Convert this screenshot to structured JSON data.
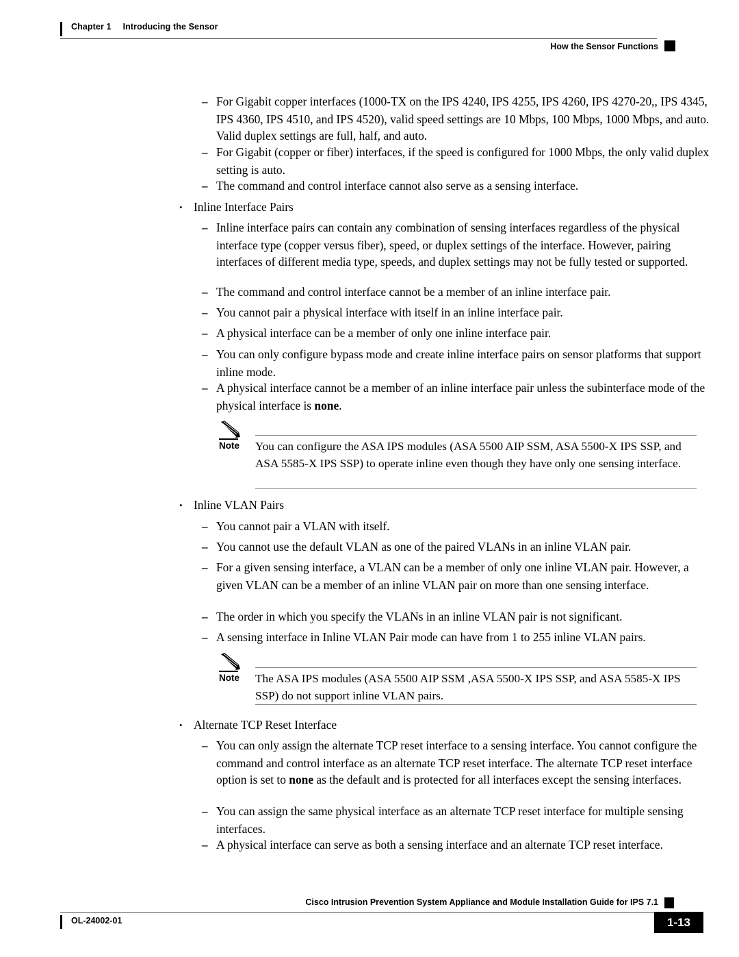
{
  "header": {
    "chapter_number": "Chapter 1",
    "chapter_title": "Introducing the Sensor",
    "section_title": "How the Sensor Functions"
  },
  "footer": {
    "guide_title": "Cisco Intrusion Prevention System Appliance and Module Installation Guide for IPS 7.1",
    "document_id": "OL-24002-01",
    "page_number": "1-13"
  },
  "body": {
    "items": [
      {
        "id": "gigabit-copper-speed",
        "level": 2,
        "text": "For Gigabit copper interfaces (1000-TX on the IPS 4240, IPS 4255, IPS 4260, IPS 4270-20,, IPS 4345, IPS 4360, IPS 4510, and IPS 4520), valid speed settings are 10 Mbps, 100 Mbps, 1000 Mbps, and auto. Valid duplex settings are full, half, and auto."
      },
      {
        "id": "gigabit-duplex-auto",
        "level": 2,
        "text": "For Gigabit (copper or fiber) interfaces, if the speed is configured for 1000 Mbps, the only valid duplex setting is auto."
      },
      {
        "id": "command-control-not-sensing",
        "level": 2,
        "text": "The command and control interface cannot also serve as a sensing interface."
      },
      {
        "id": "inline-interface-pairs-heading",
        "level": 1,
        "text": "Inline Interface Pairs"
      },
      {
        "id": "inline-pairs-combination",
        "level": 2,
        "text": "Inline interface pairs can contain any combination of sensing interfaces regardless of the physical interface type (copper versus fiber), speed, or duplex settings of the interface. However, pairing interfaces of different media type, speeds, and duplex settings may not be fully tested or supported."
      },
      {
        "id": "command-control-not-member",
        "level": 2,
        "text": "The command and control interface cannot be a member of an inline interface pair."
      },
      {
        "id": "cannot-pair-with-itself",
        "level": 2,
        "text": "You cannot pair a physical interface with itself in an inline interface pair."
      },
      {
        "id": "member-of-only-one-pair",
        "level": 2,
        "text": "A physical interface can be a member of only one inline interface pair."
      },
      {
        "id": "bypass-mode-platforms",
        "level": 2,
        "text": "You can only configure bypass mode and create inline interface pairs on sensor platforms that support inline mode."
      },
      {
        "id": "subinterface-mode-none",
        "level": 2,
        "text_before": "A physical interface cannot be a member of an inline interface pair unless the subinterface mode of the physical interface is ",
        "bold": "none",
        "text_after": "."
      },
      {
        "id": "inline-vlan-pairs-heading",
        "level": 1,
        "text": "Inline VLAN Pairs"
      },
      {
        "id": "cannot-pair-vlan-itself",
        "level": 2,
        "text": "You cannot pair a VLAN with itself."
      },
      {
        "id": "cannot-use-default-vlan",
        "level": 2,
        "text": "You cannot use the default VLAN as one of the paired VLANs in an inline VLAN pair."
      },
      {
        "id": "vlan-member-one-pair",
        "level": 2,
        "text": "For a given sensing interface, a VLAN can be a member of only one inline VLAN pair. However, a given VLAN can be a member of an inline VLAN pair on more than one sensing interface."
      },
      {
        "id": "vlan-order-not-significant",
        "level": 2,
        "text": "The order in which you specify the VLANs in an inline VLAN pair is not significant."
      },
      {
        "id": "vlan-pair-count-range",
        "level": 2,
        "text": "A sensing interface in Inline VLAN Pair mode can have from 1 to 255 inline VLAN pairs."
      },
      {
        "id": "alternate-tcp-reset-heading",
        "level": 1,
        "text": "Alternate TCP Reset Interface"
      },
      {
        "id": "assign-alt-tcp-reset",
        "level": 2,
        "text_before": "You can only assign the alternate TCP reset interface to a sensing interface. You cannot configure the command and control interface as an alternate TCP reset interface. The alternate TCP reset interface option is set to ",
        "bold": "none",
        "text_after": " as the default and is protected for all interfaces except the sensing interfaces."
      },
      {
        "id": "same-physical-multiple-sensing",
        "level": 2,
        "text": "You can assign the same physical interface as an alternate TCP reset interface for multiple sensing interfaces."
      },
      {
        "id": "serve-as-both",
        "level": 2,
        "text": "A physical interface can serve as both a sensing interface and an alternate TCP reset interface."
      }
    ],
    "notes": [
      {
        "id": "note-asa-ips-inline",
        "label": "Note",
        "text": "You can configure the ASA IPS modules (ASA 5500 AIP SSM, ASA 5500-X IPS SSP, and ASA 5585-X IPS SSP) to operate inline even though they have only one sensing interface."
      },
      {
        "id": "note-asa-ips-no-vlan",
        "label": "Note",
        "text": "The ASA IPS modules (ASA 5500 AIP SSM ,ASA 5500-X IPS SSP, and ASA 5585-X IPS SSP) do not support inline VLAN pairs."
      }
    ]
  }
}
